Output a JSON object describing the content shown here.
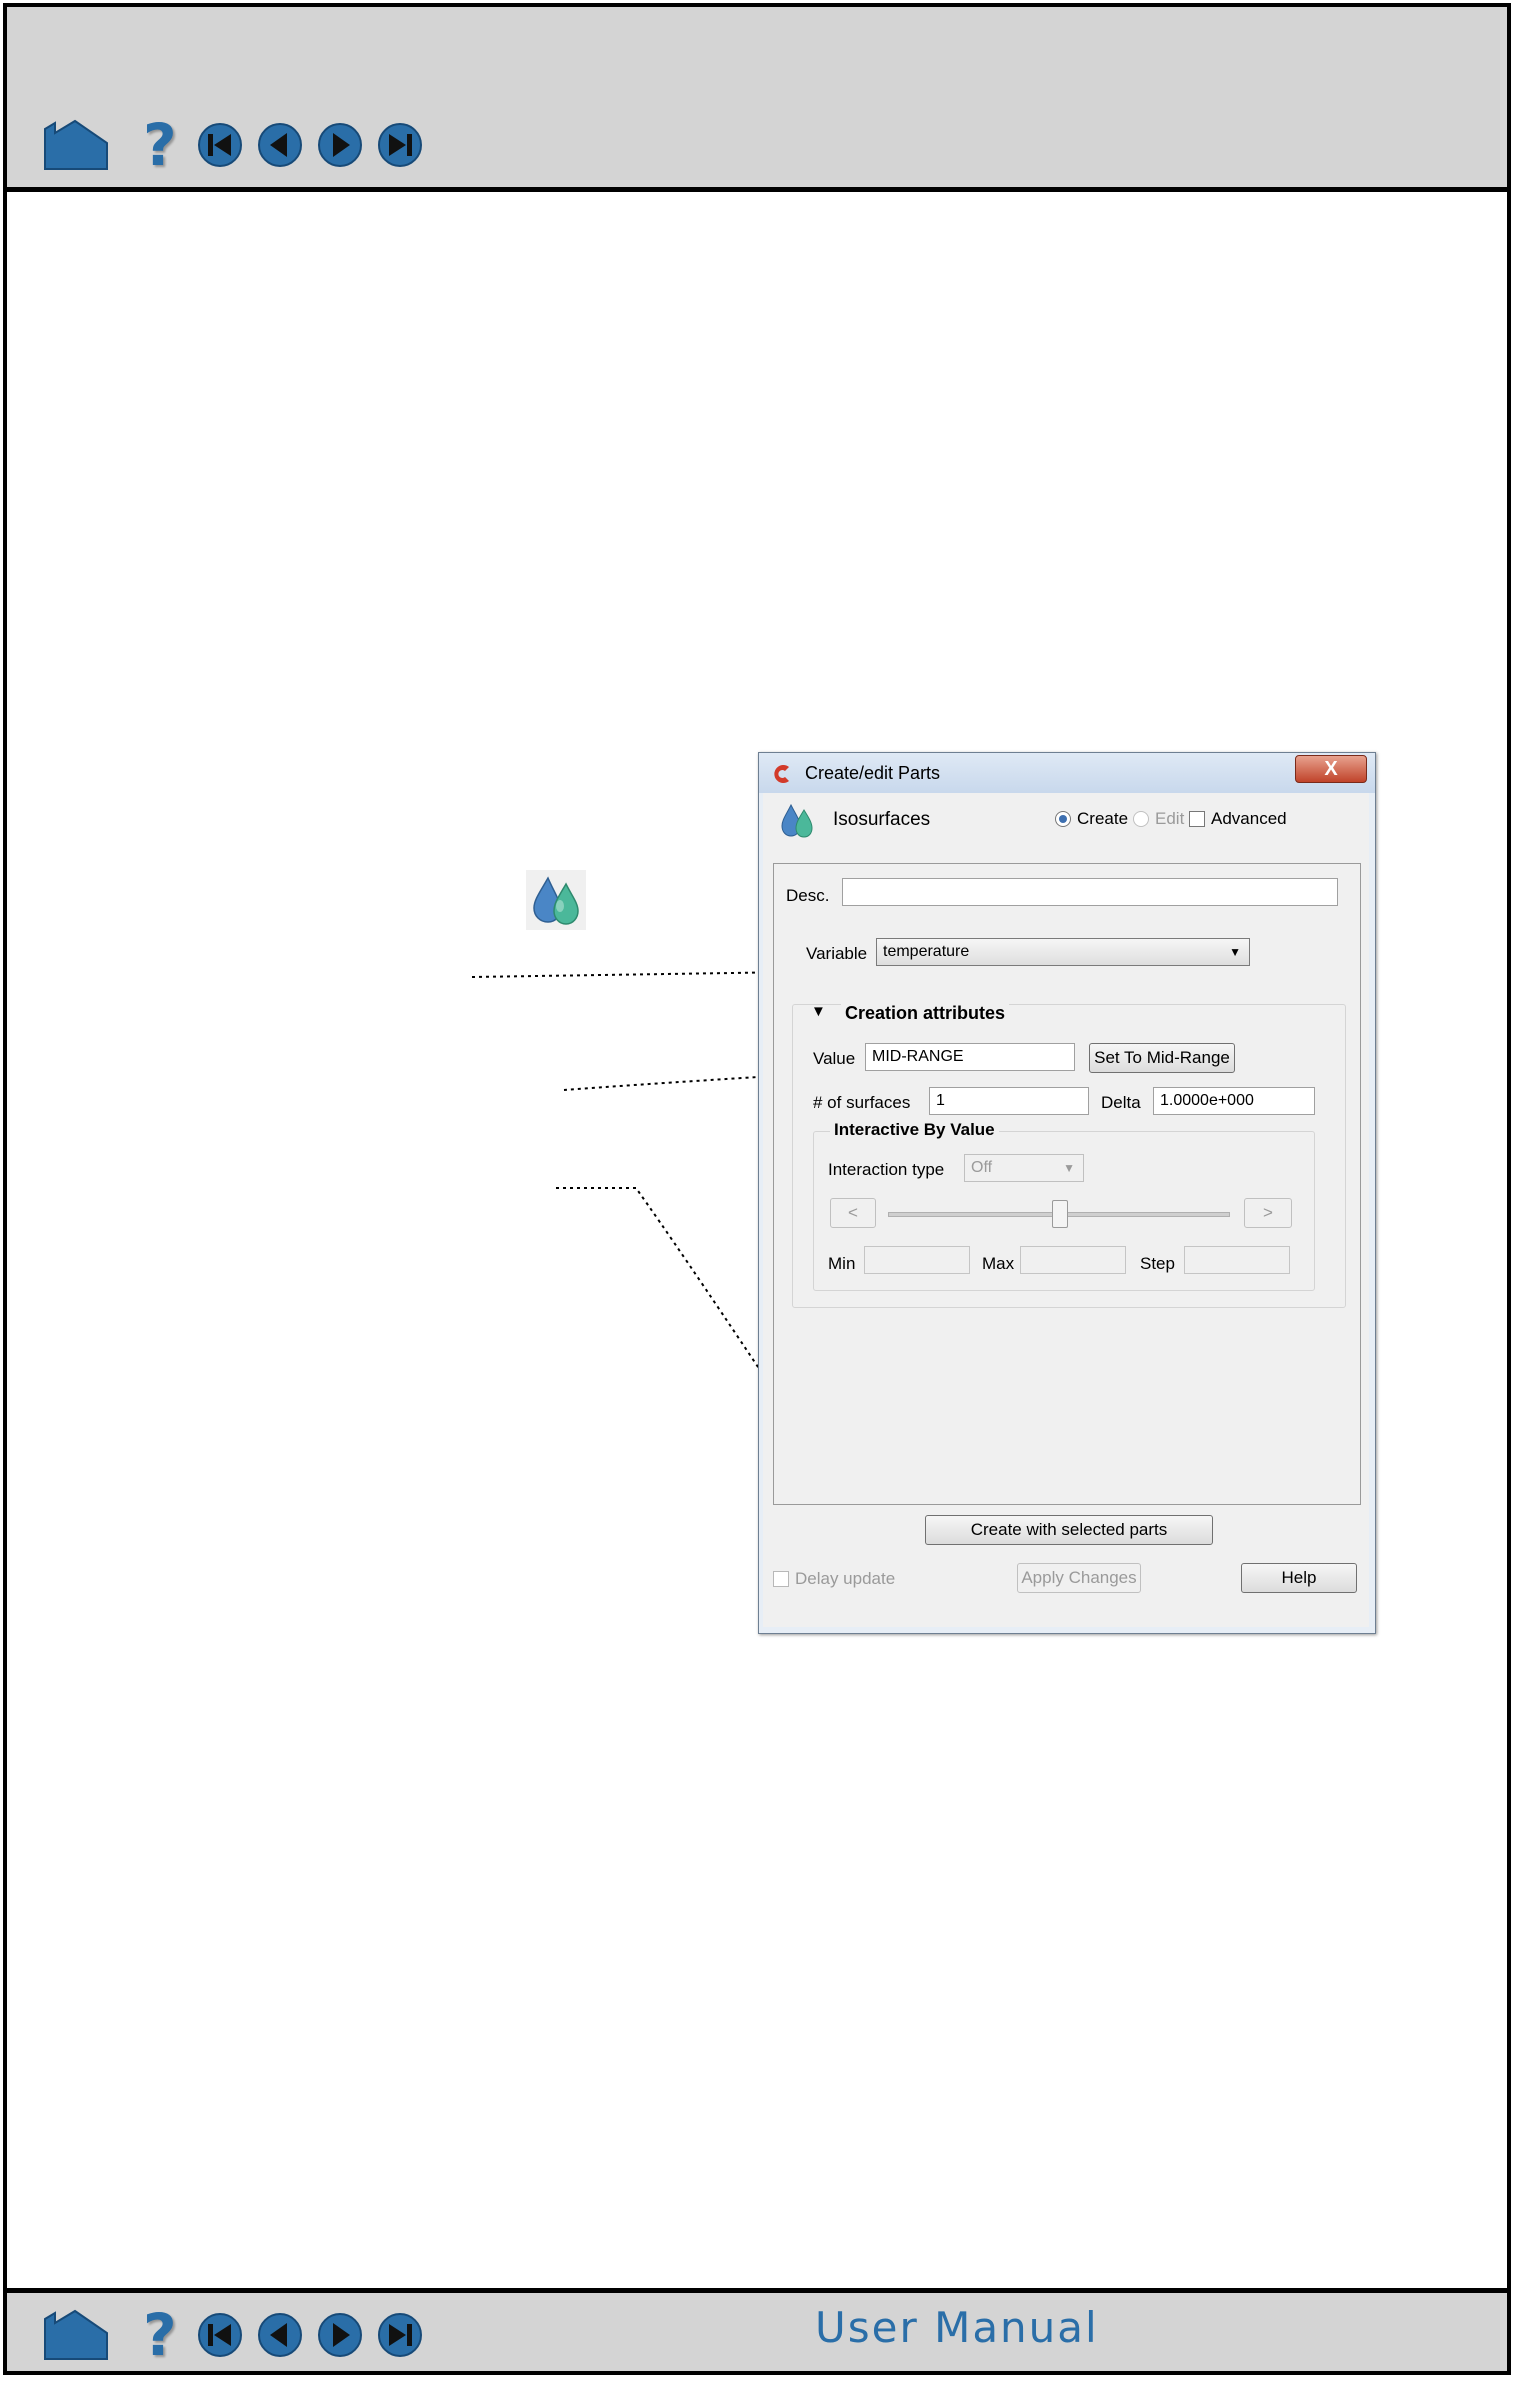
{
  "nav": {
    "icons": [
      "home-icon",
      "help-icon",
      "first-page-icon",
      "previous-page-icon",
      "next-page-icon",
      "last-page-icon"
    ],
    "help_glyph": "?"
  },
  "footer": {
    "title": "User Manual"
  },
  "colors": {
    "nav_blue": "#2a6ea8",
    "bar_gray": "#d4d4d4",
    "dialog_bg": "#f0f0f0"
  },
  "dialog": {
    "title": "Create/edit Parts",
    "close_label": "X",
    "part_type": "Isosurfaces",
    "mode": {
      "create_label": "Create",
      "edit_label": "Edit",
      "advanced_label": "Advanced",
      "selected": "Create"
    },
    "desc": {
      "label": "Desc.",
      "value": ""
    },
    "variable": {
      "label": "Variable",
      "value": "temperature"
    },
    "creation": {
      "title": "Creation attributes",
      "value_label": "Value",
      "value": "MID-RANGE",
      "set_mid_label": "Set To Mid-Range",
      "surfaces_label": "# of surfaces",
      "surfaces_value": "1",
      "delta_label": "Delta",
      "delta_value": "1.0000e+000"
    },
    "interactive": {
      "title": "Interactive By Value",
      "type_label": "Interaction type",
      "type_value": "Off",
      "prev_label": "<",
      "next_label": ">",
      "min_label": "Min",
      "max_label": "Max",
      "step_label": "Step"
    },
    "create_button": "Create with selected parts",
    "delay_update_label": "Delay update",
    "apply_label": "Apply Changes",
    "help_label": "Help"
  }
}
